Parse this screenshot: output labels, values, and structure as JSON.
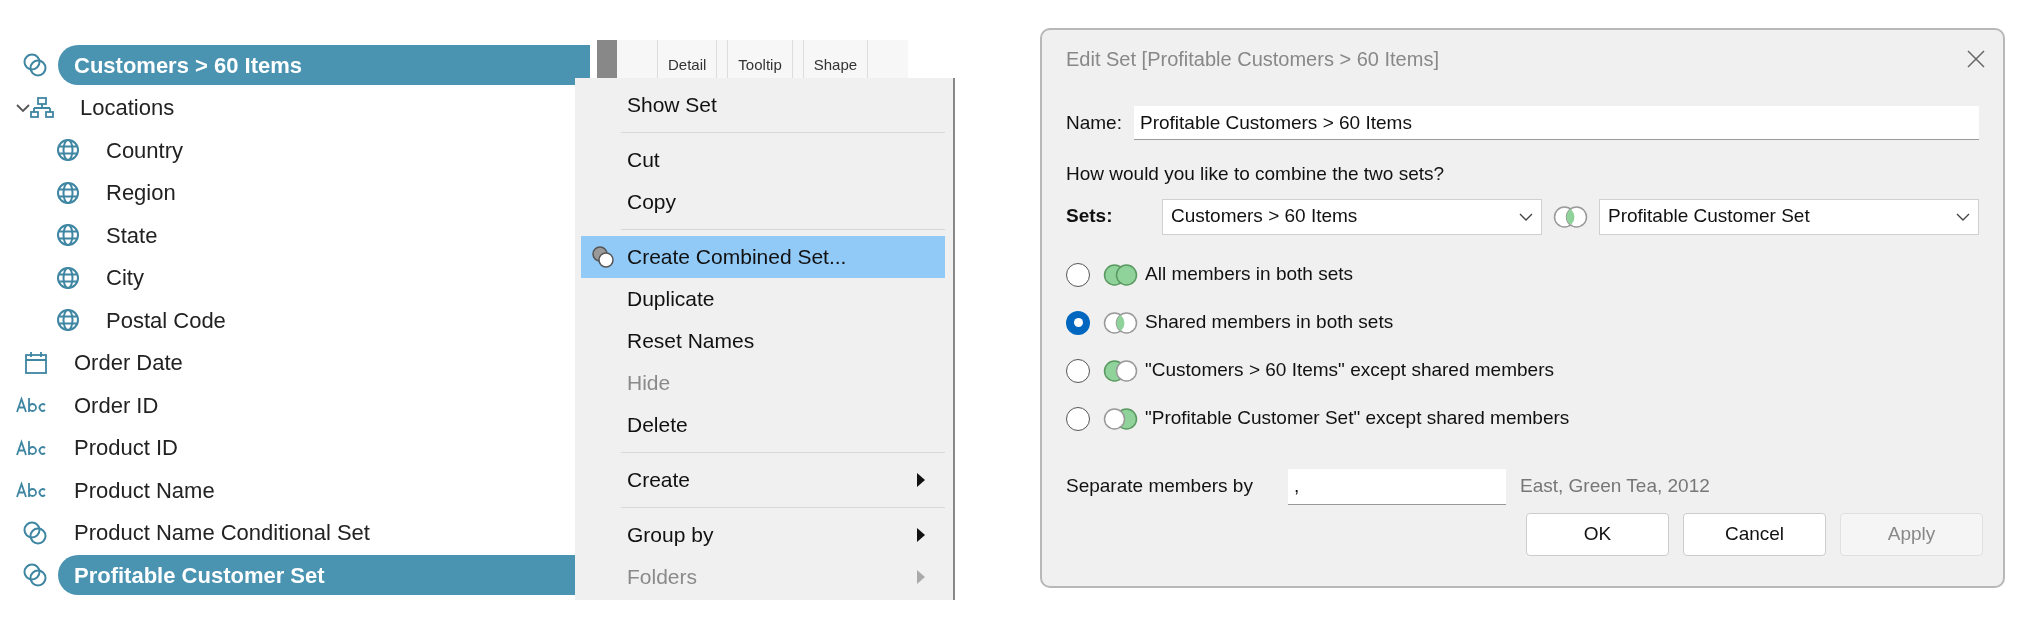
{
  "data_pane": {
    "items": [
      {
        "kind": "set",
        "label": "Customers > 60 Items",
        "selected": true
      },
      {
        "kind": "hierarchy",
        "label": "Locations",
        "selected": false,
        "expanded": true,
        "children": [
          {
            "kind": "geo",
            "label": "Country",
            "selected": false
          },
          {
            "kind": "geo",
            "label": "Region",
            "selected": false
          },
          {
            "kind": "geo",
            "label": "State",
            "selected": false
          },
          {
            "kind": "geo",
            "label": "City",
            "selected": false
          },
          {
            "kind": "geo",
            "label": "Postal Code",
            "selected": false
          }
        ]
      },
      {
        "kind": "date",
        "label": "Order Date",
        "selected": false
      },
      {
        "kind": "text",
        "label": "Order ID",
        "selected": false
      },
      {
        "kind": "text",
        "label": "Product ID",
        "selected": false
      },
      {
        "kind": "text",
        "label": "Product Name",
        "selected": false
      },
      {
        "kind": "set",
        "label": "Product Name Conditional Set",
        "selected": false
      },
      {
        "kind": "set",
        "label": "Profitable Customer Set",
        "selected": true
      }
    ]
  },
  "shelf_tabs": [
    "Detail",
    "Tooltip",
    "Shape"
  ],
  "context_menu": {
    "groups": [
      [
        {
          "kind": "plain",
          "label": "Show Set",
          "selected": false,
          "disabled": false
        }
      ],
      [
        {
          "kind": "plain",
          "label": "Cut",
          "selected": false,
          "disabled": false
        },
        {
          "kind": "plain",
          "label": "Copy",
          "selected": false,
          "disabled": false
        }
      ],
      [
        {
          "kind": "combine",
          "label": "Create Combined Set...",
          "selected": true,
          "disabled": false
        },
        {
          "kind": "plain",
          "label": "Duplicate",
          "selected": false,
          "disabled": false
        },
        {
          "kind": "plain",
          "label": "Reset Names",
          "selected": false,
          "disabled": false
        },
        {
          "kind": "plain",
          "label": "Hide",
          "selected": false,
          "disabled": true
        },
        {
          "kind": "plain",
          "label": "Delete",
          "selected": false,
          "disabled": false
        }
      ],
      [
        {
          "kind": "submenu",
          "label": "Create",
          "selected": false,
          "disabled": false
        }
      ],
      [
        {
          "kind": "submenu",
          "label": "Group by",
          "selected": false,
          "disabled": false
        },
        {
          "kind": "submenu",
          "label": "Folders",
          "selected": false,
          "disabled": true
        }
      ]
    ]
  },
  "dialog": {
    "title": "Edit Set [Profitable Customers > 60 Items]",
    "name": {
      "label": "Name:",
      "value": "Profitable Customers > 60 Items"
    },
    "question": "How would you like to combine the two sets?",
    "sets": {
      "label": "Sets:",
      "first": "Customers > 60 Items",
      "second": "Profitable Customer Set"
    },
    "options": [
      {
        "kind": "all",
        "label": "All members in both sets",
        "selected": false
      },
      {
        "kind": "shared",
        "label": "Shared members in both sets",
        "selected": true
      },
      {
        "kind": "left",
        "label": "\"Customers > 60 Items\" except shared members",
        "selected": false
      },
      {
        "kind": "right",
        "label": "\"Profitable Customer Set\" except shared members",
        "selected": false
      }
    ],
    "separator": {
      "label": "Separate members by",
      "value": ",",
      "example": "East, Green Tea, 2012"
    },
    "buttons": [
      {
        "label": "OK",
        "disabled": false
      },
      {
        "label": "Cancel",
        "disabled": false
      },
      {
        "label": "Apply",
        "disabled": true
      }
    ]
  }
}
